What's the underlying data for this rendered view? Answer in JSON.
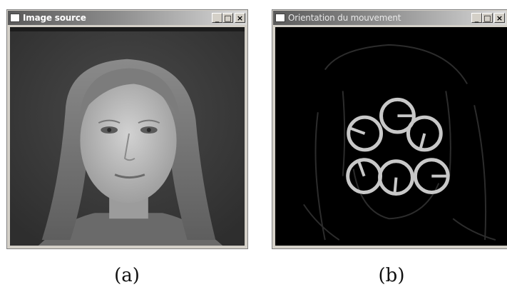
{
  "windows": [
    {
      "title": "Image source",
      "controls": {
        "minimize": "_",
        "maximize": "□",
        "close": "×"
      }
    },
    {
      "title": "Orientation du mouvement",
      "controls": {
        "minimize": "_",
        "maximize": "□",
        "close": "×"
      }
    }
  ],
  "captions": [
    "(a)",
    "(b)"
  ],
  "motion_orientation": {
    "circles": [
      {
        "label": "top-center",
        "angle_deg": 0
      },
      {
        "label": "upper-left",
        "angle_deg": 200
      },
      {
        "label": "upper-right",
        "angle_deg": 105
      },
      {
        "label": "lower-left",
        "angle_deg": 250
      },
      {
        "label": "lower-center",
        "angle_deg": 95
      },
      {
        "label": "lower-right",
        "angle_deg": 0
      }
    ],
    "circle_color": "#c8c8c8"
  }
}
